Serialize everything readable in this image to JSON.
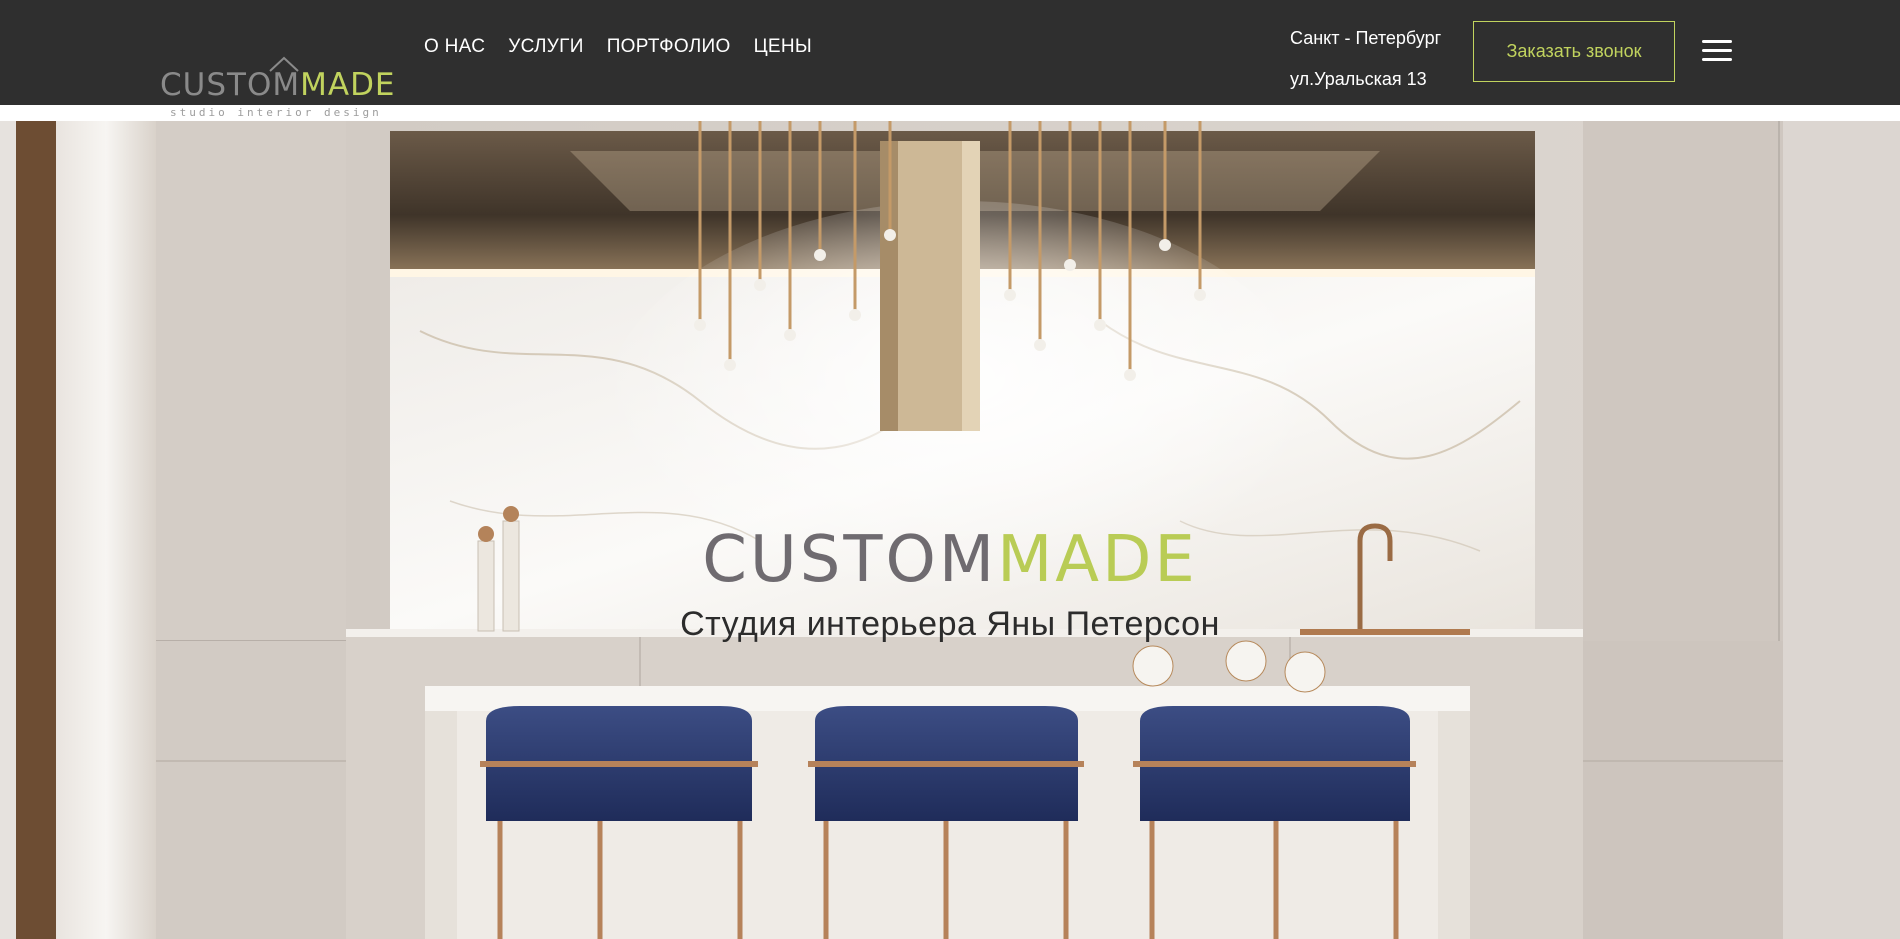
{
  "header": {
    "logo": {
      "word1": "CUSTOM",
      "word2": "MADE",
      "tagline": "studio interior design"
    },
    "nav": [
      {
        "label": "О НАС"
      },
      {
        "label": "УСЛУГИ"
      },
      {
        "label": "ПОРТФОЛИО"
      },
      {
        "label": "ЦЕНЫ"
      }
    ],
    "address": {
      "city": "Санкт - Петербург",
      "street": "ул.Уральская 13"
    },
    "callback_label": "Заказать звонок",
    "menu_icon": "hamburger-menu-icon"
  },
  "hero": {
    "logo": {
      "word1": "CUSTOM",
      "word2": "MADE"
    },
    "subtitle": "Студия интерьера Яны Петерсон",
    "image": "kitchen-interior-photo"
  },
  "colors": {
    "header_bg": "#2f2f2f",
    "accent": "#c1d35e",
    "logo_gray": "#8a8a8a"
  }
}
